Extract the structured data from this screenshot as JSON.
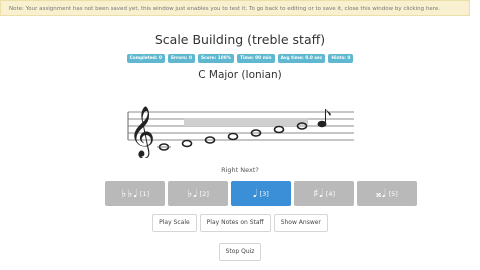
{
  "notice": "Note: Your assignment has not been saved yet, this window just enables you to test it. To go back to editing or to save it, close this window by clicking here.",
  "title": "Scale Building (treble staff)",
  "stats": [
    "Completed: 0",
    "Errors: 0",
    "Score: 100%",
    "Time: 00 min",
    "Avg time: 0.0 sec",
    "Hints: 0"
  ],
  "subtitle": "C Major (Ionian)",
  "prompt": "Right Next?",
  "answers": [
    {
      "glyph": "♭♭𝅘𝅥",
      "num": "[1]"
    },
    {
      "glyph": "♭𝅘𝅥",
      "num": "[2]"
    },
    {
      "glyph": "𝅘𝅥",
      "num": "[3]"
    },
    {
      "glyph": "♯𝅘𝅥",
      "num": "[4]"
    },
    {
      "glyph": "𝄪𝅘𝅥",
      "num": "[5]"
    }
  ],
  "controls": {
    "play_scale": "Play Scale",
    "play_notes": "Play Notes on Staff",
    "show_answer": "Show Answer"
  },
  "stop_quiz": "Stop Quiz",
  "colors": {
    "selected": "#3a8fd6",
    "unselected": "#b9b9b9",
    "badge": "#5fb8cf",
    "notice_bg": "#f8f0cf"
  }
}
